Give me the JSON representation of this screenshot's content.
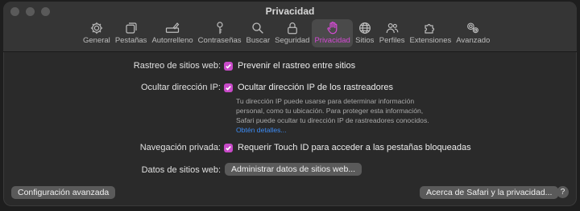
{
  "window": {
    "title": "Privacidad"
  },
  "tabs": [
    {
      "label": "General",
      "icon": "gear-icon"
    },
    {
      "label": "Pestañas",
      "icon": "tabs-icon"
    },
    {
      "label": "Autorrelleno",
      "icon": "pen-icon"
    },
    {
      "label": "Contraseñas",
      "icon": "key-icon"
    },
    {
      "label": "Buscar",
      "icon": "magnifier-icon"
    },
    {
      "label": "Seguridad",
      "icon": "lock-icon"
    },
    {
      "label": "Privacidad",
      "icon": "hand-icon",
      "active": true
    },
    {
      "label": "Sitios",
      "icon": "globe-icon"
    },
    {
      "label": "Perfiles",
      "icon": "people-icon"
    },
    {
      "label": "Extensiones",
      "icon": "puzzle-icon"
    },
    {
      "label": "Avanzado",
      "icon": "gears-icon"
    }
  ],
  "settings": {
    "tracking": {
      "label": "Rastreo de sitios web:",
      "option": "Prevenir el rastreo entre sitios",
      "checked": true
    },
    "hide_ip": {
      "label": "Ocultar dirección IP:",
      "option": "Ocultar dirección IP de los rastreadores",
      "checked": true,
      "desc1": "Tu dirección IP puede usarse para determinar información",
      "desc2": "personal, como tu ubicación. Para proteger esta información,",
      "desc3": "Safari puede ocultar tu dirección IP de rastreadores conocidos.",
      "link": "Obtén detalles..."
    },
    "private": {
      "label": "Navegación privada:",
      "option": "Requerir Touch ID para acceder a las pestañas bloqueadas",
      "checked": true
    },
    "site_data": {
      "label": "Datos de sitios web:",
      "button": "Administrar datos de sitios web..."
    }
  },
  "footer": {
    "advanced_button": "Configuración avanzada",
    "about_button": "Acerca de Safari y la privacidad...",
    "help": "?"
  },
  "colors": {
    "accent": "#c94bc9",
    "link": "#3d8cf5"
  }
}
